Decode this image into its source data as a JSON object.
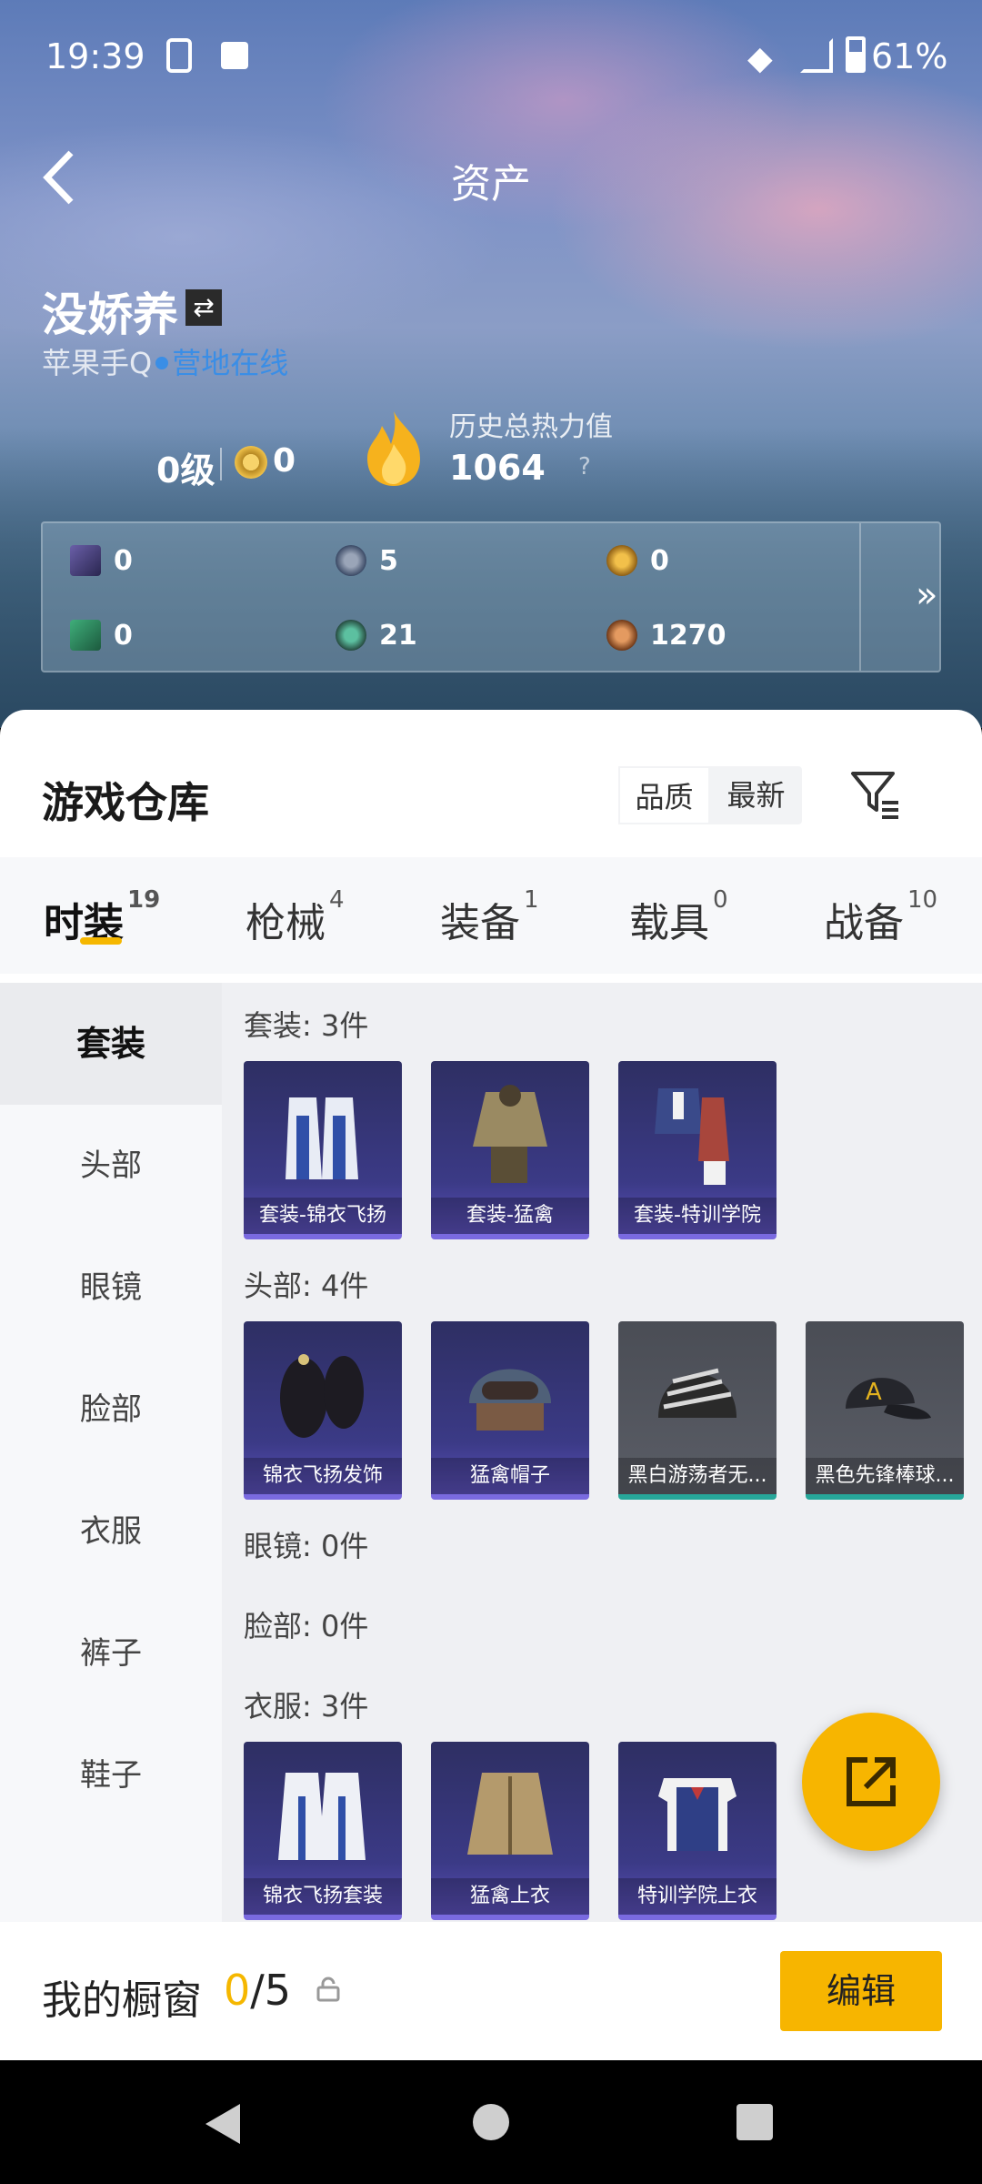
{
  "status_bar": {
    "time": "19:39",
    "battery": "61%"
  },
  "header": {
    "title": "资产"
  },
  "profile": {
    "name": "没娇养",
    "platform": "苹果手Q",
    "online_status": "营地在线",
    "level": "0级",
    "medals": "0",
    "heat_label": "历史总热力值",
    "heat_value": "1064",
    "heat_help": "?"
  },
  "currencies": {
    "row1": [
      "0",
      "5",
      "0"
    ],
    "row2": [
      "0",
      "21",
      "1270"
    ],
    "more": "»"
  },
  "warehouse": {
    "title": "游戏仓库",
    "sort_options": [
      "品质",
      "最新"
    ],
    "sort_selected": "品质"
  },
  "tabs": [
    {
      "label": "时装",
      "count": "19"
    },
    {
      "label": "枪械",
      "count": "4"
    },
    {
      "label": "装备",
      "count": "1"
    },
    {
      "label": "载具",
      "count": "0"
    },
    {
      "label": "战备",
      "count": "10"
    }
  ],
  "side_nav": [
    "套装",
    "头部",
    "眼镜",
    "脸部",
    "衣服",
    "裤子",
    "鞋子"
  ],
  "sections": {
    "suit": {
      "label": "套装: 3件",
      "items": [
        "套装-锦衣飞扬",
        "套装-猛禽",
        "套装-特训学院"
      ]
    },
    "head": {
      "label": "头部: 4件",
      "items": [
        "锦衣飞扬发饰",
        "猛禽帽子",
        "黑白游荡者无...",
        "黑色先锋棒球..."
      ]
    },
    "glasses": {
      "label": "眼镜: 0件"
    },
    "face": {
      "label": "脸部: 0件"
    },
    "clothes": {
      "label": "衣服: 3件",
      "items": [
        "锦衣飞扬套装",
        "猛禽上衣",
        "特训学院上衣"
      ]
    }
  },
  "showcase": {
    "title": "我的橱窗",
    "current": "0",
    "total": "/5",
    "edit_label": "编辑"
  },
  "colors": {
    "accent": "#f7b500",
    "online": "#3a8ee6",
    "card_purple": "#3b3a86",
    "card_grey": "#5a5d66"
  }
}
